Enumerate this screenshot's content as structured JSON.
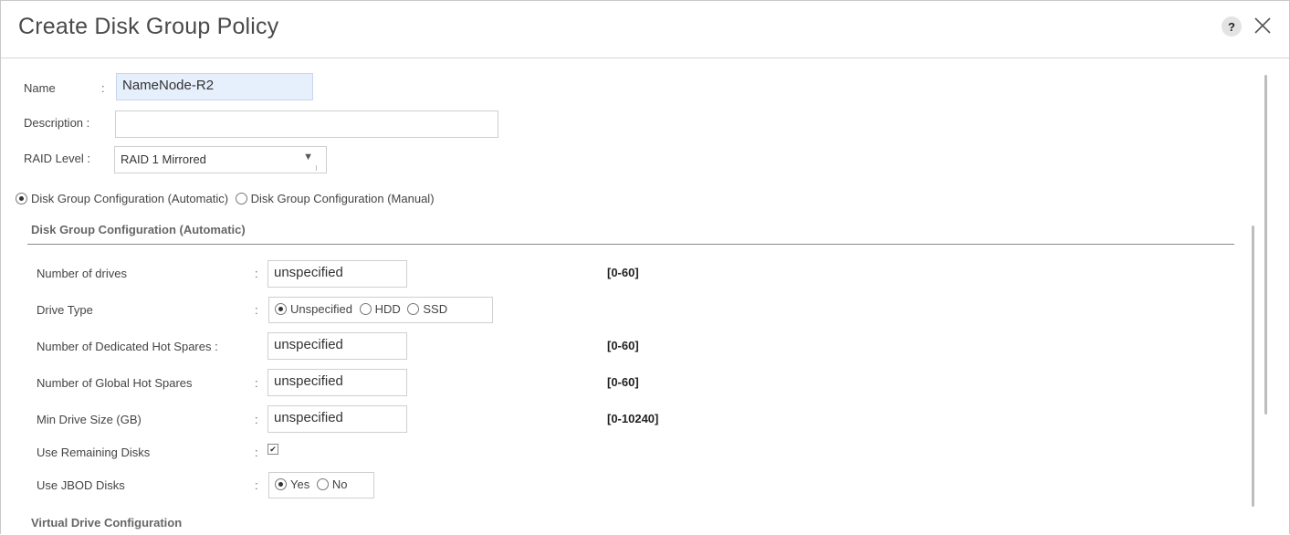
{
  "dialog": {
    "title": "Create Disk Group Policy",
    "help_icon": "help-icon",
    "help_label": "?",
    "close_icon": "close-icon"
  },
  "form": {
    "name_label": "Name",
    "name_value": "NameNode-R2",
    "description_label": "Description :",
    "description_value": "",
    "raid_label": "RAID Level :",
    "raid_value": "RAID 1 Mirrored",
    "raid_arrow": "▼",
    "colon": ":"
  },
  "config_mode": {
    "automatic_label": "Disk Group Configuration (Automatic)",
    "manual_label": "Disk Group Configuration (Manual)",
    "selected": "automatic"
  },
  "auto_section": {
    "title": "Disk Group Configuration (Automatic)",
    "rows": {
      "num_drives": {
        "label": "Number of drives",
        "value": "unspecified",
        "range": "[0-60]"
      },
      "drive_type": {
        "label": "Drive Type",
        "options": [
          "Unspecified",
          "HDD",
          "SSD"
        ],
        "selected": "Unspecified"
      },
      "dedicated_spares": {
        "label": "Number of Dedicated Hot Spares :",
        "value": "unspecified",
        "range": "[0-60]"
      },
      "global_spares": {
        "label": "Number of Global Hot Spares",
        "value": "unspecified",
        "range": "[0-60]"
      },
      "min_drive_size": {
        "label": "Min Drive Size (GB)",
        "value": "unspecified",
        "range": "[0-10240]"
      },
      "use_remaining": {
        "label": "Use Remaining Disks",
        "checked": true
      },
      "use_jbod": {
        "label": "Use JBOD Disks",
        "options": [
          "Yes",
          "No"
        ],
        "selected": "Yes"
      }
    }
  },
  "virtual_section": {
    "title": "Virtual Drive Configuration"
  },
  "colors": {
    "name_field_bg": "#e6effc",
    "section_line": "#8a8a8a"
  }
}
